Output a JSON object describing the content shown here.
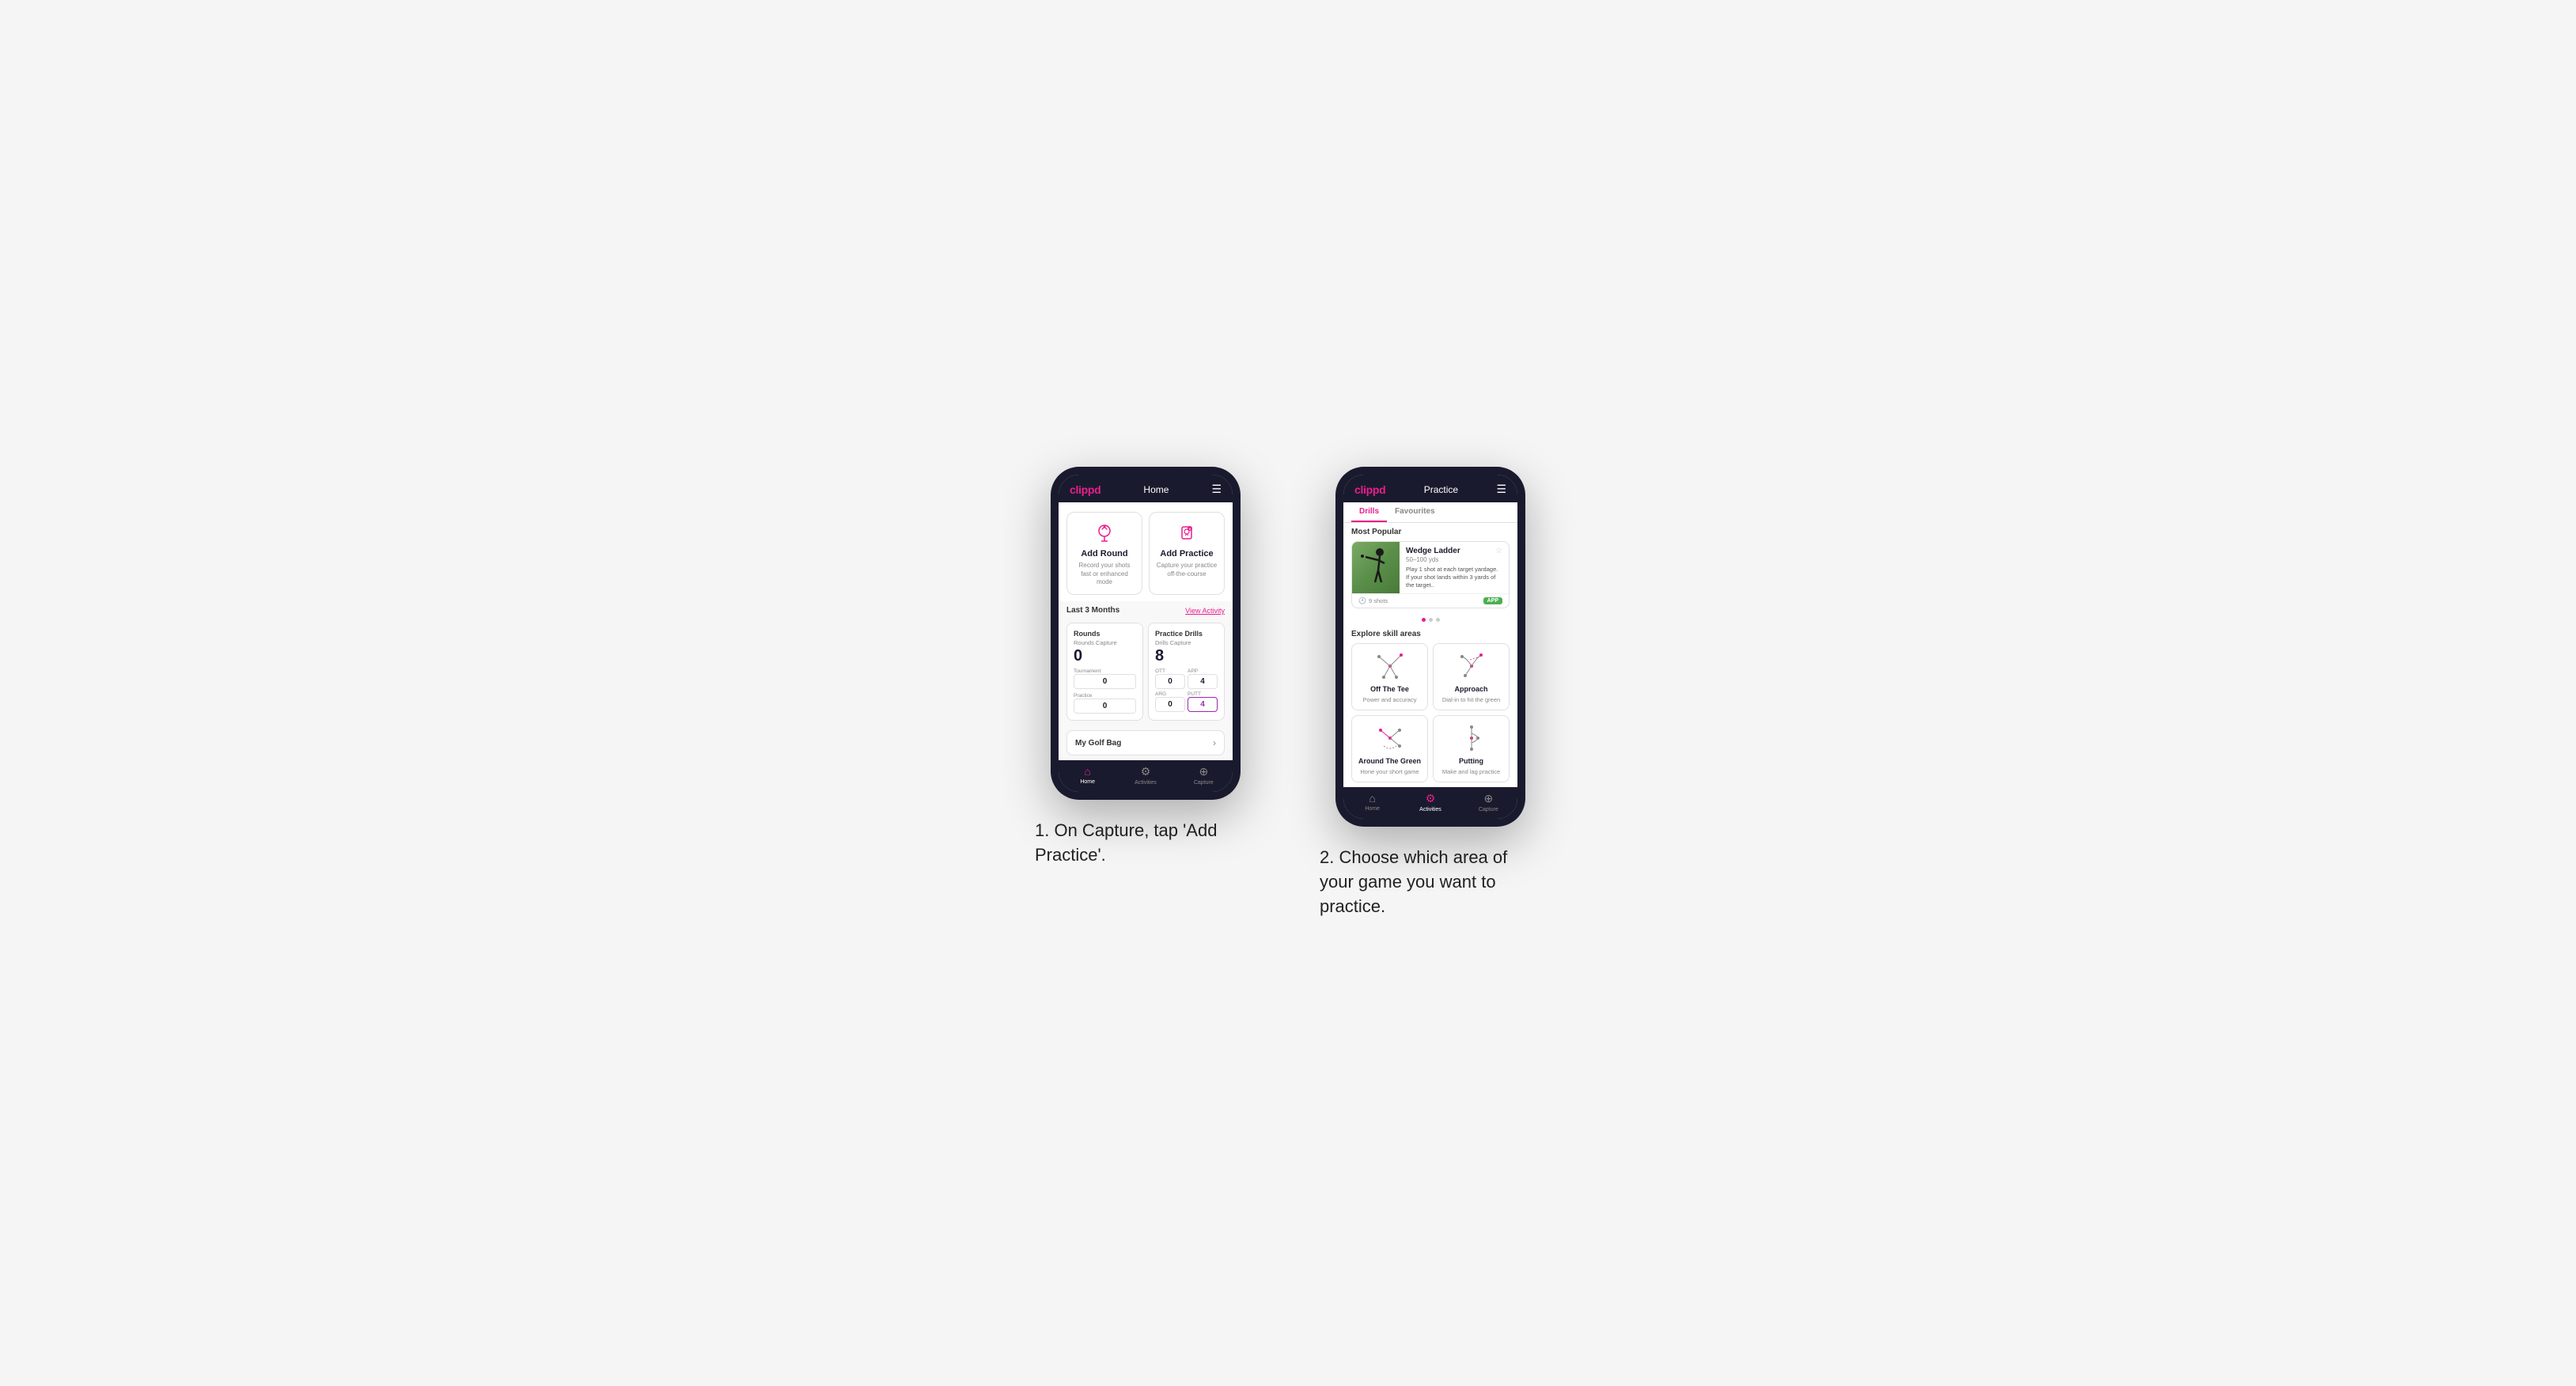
{
  "phone1": {
    "header": {
      "logo": "clippd",
      "title": "Home",
      "menu_icon": "☰"
    },
    "action_cards": [
      {
        "id": "add-round",
        "title": "Add Round",
        "subtitle": "Record your shots fast or enhanced mode",
        "icon_color": "#e91e8c"
      },
      {
        "id": "add-practice",
        "title": "Add Practice",
        "subtitle": "Capture your practice off-the-course",
        "icon_color": "#e91e8c"
      }
    ],
    "activity": {
      "title": "Last 3 Months",
      "link": "View Activity"
    },
    "stats": {
      "rounds": {
        "title": "Rounds",
        "capture_label": "Rounds Capture",
        "capture_value": "0",
        "tournament_label": "Tournament",
        "tournament_value": "0",
        "practice_label": "Practice",
        "practice_value": "0"
      },
      "practice_drills": {
        "title": "Practice Drills",
        "capture_label": "Drills Capture",
        "capture_value": "8",
        "ott_label": "OTT",
        "ott_value": "0",
        "app_label": "APP",
        "app_value": "4",
        "arg_label": "ARG",
        "arg_value": "0",
        "putt_label": "PUTT",
        "putt_value": "4"
      }
    },
    "my_golf_bag": "My Golf Bag",
    "bottom_nav": [
      {
        "id": "home",
        "label": "Home",
        "active": true
      },
      {
        "id": "activities",
        "label": "Activities",
        "active": false
      },
      {
        "id": "capture",
        "label": "Capture",
        "active": false
      }
    ]
  },
  "phone2": {
    "header": {
      "logo": "clippd",
      "title": "Practice",
      "menu_icon": "☰"
    },
    "tabs": [
      {
        "id": "drills",
        "label": "Drills",
        "active": true
      },
      {
        "id": "favourites",
        "label": "Favourites",
        "active": false
      }
    ],
    "most_popular": {
      "heading": "Most Popular",
      "featured_card": {
        "title": "Wedge Ladder",
        "yds": "50–100 yds",
        "description": "Play 1 shot at each target yardage. If your shot lands within 3 yards of the target..",
        "shots": "9 shots",
        "badge": "APP"
      },
      "dots": [
        true,
        false,
        false
      ]
    },
    "explore": {
      "heading": "Explore skill areas",
      "skills": [
        {
          "id": "off-the-tee",
          "title": "Off The Tee",
          "subtitle": "Power and accuracy",
          "icon_type": "tee"
        },
        {
          "id": "approach",
          "title": "Approach",
          "subtitle": "Dial-in to hit the green",
          "icon_type": "approach"
        },
        {
          "id": "around-the-green",
          "title": "Around The Green",
          "subtitle": "Hone your short game",
          "icon_type": "atg"
        },
        {
          "id": "putting",
          "title": "Putting",
          "subtitle": "Make and lag practice",
          "icon_type": "putting"
        }
      ]
    },
    "bottom_nav": [
      {
        "id": "home",
        "label": "Home",
        "active": false
      },
      {
        "id": "activities",
        "label": "Activities",
        "active": true
      },
      {
        "id": "capture",
        "label": "Capture",
        "active": false
      }
    ]
  },
  "captions": {
    "phone1_caption": "1. On Capture, tap 'Add Practice'.",
    "phone2_caption": "2. Choose which area of your game you want to practice."
  },
  "colors": {
    "brand_pink": "#e91e8c",
    "dark_nav": "#1a1a2e",
    "green_badge": "#4caf50",
    "purple_highlight": "#9c27b0"
  }
}
